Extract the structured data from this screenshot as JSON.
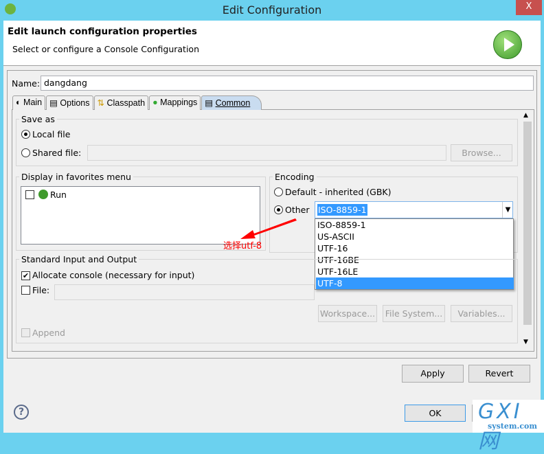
{
  "window": {
    "title": "Edit Configuration",
    "close": "X"
  },
  "header": {
    "title": "Edit launch configuration properties",
    "subtitle": "Select or configure a Console Configuration"
  },
  "name": {
    "label": "Name:",
    "value": "dangdang"
  },
  "tabs": [
    {
      "label": "Main"
    },
    {
      "label": "Options"
    },
    {
      "label": "Classpath"
    },
    {
      "label": "Mappings"
    },
    {
      "label": "Common",
      "active": true
    }
  ],
  "save_as": {
    "label": "Save as",
    "local": "Local file",
    "shared": "Shared file:",
    "browse": "Browse..."
  },
  "favorites": {
    "label": "Display in favorites menu",
    "items": [
      {
        "label": "Run",
        "checked": false
      }
    ]
  },
  "encoding": {
    "label": "Encoding",
    "default": "Default - inherited (GBK)",
    "other": "Other",
    "selected": "ISO-8859-1",
    "options": [
      "ISO-8859-1",
      "US-ASCII",
      "UTF-16",
      "UTF-16BE",
      "UTF-16LE",
      "UTF-8"
    ],
    "highlighted": "UTF-8"
  },
  "annotation": "选择utf-8",
  "stdio": {
    "label": "Standard Input and Output",
    "allocate": "Allocate console (necessary for input)",
    "file": "File:",
    "workspace": "Workspace...",
    "filesystem": "File System...",
    "variables": "Variables...",
    "append": "Append"
  },
  "buttons": {
    "apply": "Apply",
    "revert": "Revert",
    "ok": "OK"
  },
  "watermark": {
    "main": "GXI网",
    "sub": "system.com"
  },
  "colors": {
    "titlebar": "#6bd1ef",
    "selection": "#3399ff",
    "annotation": "#ff0000"
  }
}
